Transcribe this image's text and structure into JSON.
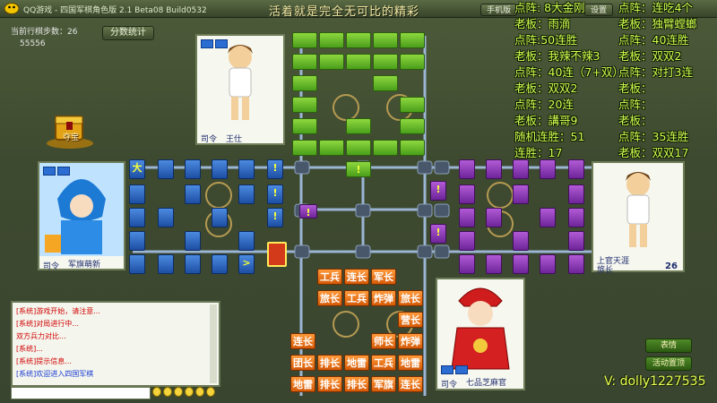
{
  "window": {
    "title": "QQ游戏 - 四国军棋角色版 2.1 Beta08 Build0532",
    "slogan": "活着就是完全无可比的精彩",
    "buttons": [
      "手机版",
      "设置"
    ]
  },
  "left_hud": {
    "step_label": "当前行棋步数：26",
    "score": "55556",
    "stats_button": "分数统计",
    "treasure_label": "夺宝"
  },
  "players": {
    "top": {
      "name": "王仕",
      "rank": "司令"
    },
    "left": {
      "name": "军旗萌新",
      "rank": "司令"
    },
    "right": {
      "name": "上官天涯",
      "rank": "旅长",
      "count": "26"
    },
    "bottom": {
      "name": "七品芝麻官",
      "rank": "司令"
    }
  },
  "board": {
    "left_marks": [
      "大",
      ">"
    ],
    "bottom_pieces": [
      [
        "工兵",
        "连长",
        "军长"
      ],
      [
        "旅长",
        "工兵",
        "炸弹",
        "旅长"
      ],
      [
        "营长"
      ],
      [
        "连长",
        "师长",
        "炸弹"
      ],
      [
        "团长",
        "排长",
        "地雷",
        "工兵",
        "地雷"
      ],
      [
        "地雷",
        "排长",
        "排长",
        "军旗",
        "连长"
      ]
    ]
  },
  "chat": {
    "lines": [
      "[系统]游戏开始，请注意...",
      "[系统]对局进行中...",
      "双方兵力对比...",
      "[系统]...",
      "[系统]提示信息...",
      "[系统]欢迎进入四国军棋"
    ]
  },
  "overlay": {
    "col1": [
      "点阵: 8大金刚",
      "老板：雨滴",
      "点阵:50连胜",
      "老板：我辣不辣3",
      "点阵：40连（7+双）",
      "老板：双双2",
      "点阵：20连",
      "老板：講哥9",
      "随机连胜：51",
      "连胜：17"
    ],
    "col2": [
      "点阵：连吃4个",
      "老板：独臂螳螂",
      "点阵：40连胜",
      "老板：双双2",
      "点阵：对打3连",
      "老板：",
      "点阵：",
      "老板：",
      "点阵：35连胜",
      "老板：双双17"
    ],
    "streamer": "V: dolly1227535"
  },
  "side_buttons": [
    "表情",
    "活动置顶"
  ],
  "colors": {
    "green": "#5db226",
    "blue": "#2a62c2",
    "purple": "#8c3bbf",
    "orange": "#e36d14",
    "overlay_text": "#d2ff52"
  }
}
